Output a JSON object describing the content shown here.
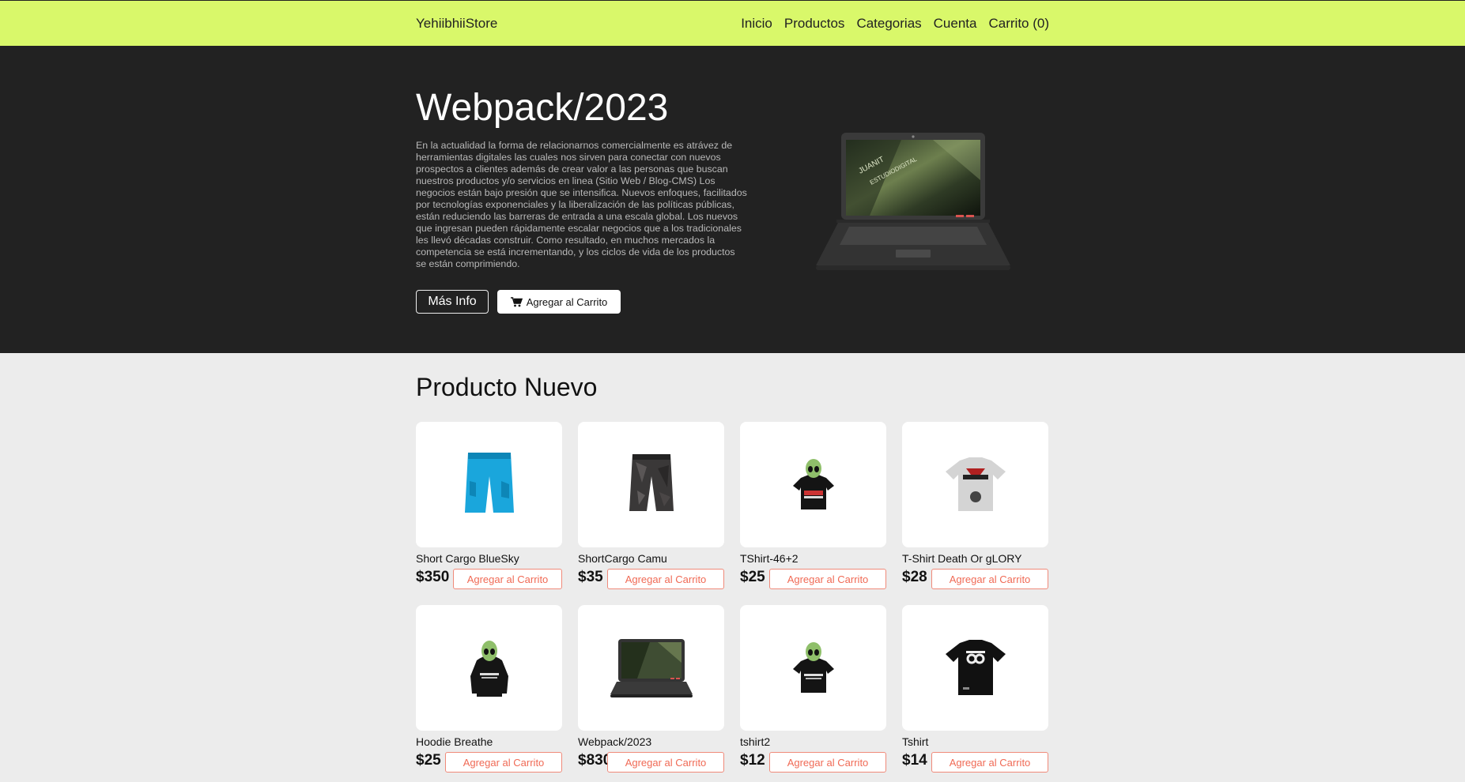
{
  "header": {
    "brand": "YehiibhiiStore",
    "nav": [
      "Inicio",
      "Productos",
      "Categorias",
      "Cuenta",
      "Carrito (0)"
    ]
  },
  "hero": {
    "title": "Webpack/2023",
    "description": "En la actualidad la forma de relacionarnos comercialmente es atrávez de herramientas digitales las cuales nos sirven para conectar con nuevos prospectos a clientes además de crear valor a las personas que buscan nuestros productos y/o servicios en linea (Sitio Web / Blog-CMS) Los negocios están bajo presión que se intensifica. Nuevos enfoques, facilitados por tecnologías exponenciales y la liberalización de las políticas públicas, están reduciendo las barreras de entrada a una escala global. Los nuevos que ingresan pueden rápidamente escalar negocios que a los tradicionales les llevó décadas construir. Como resultado, en muchos mercados la competencia se está incrementando, y los ciclos de vida de los productos se están comprimiendo.",
    "info_button": "Más Info",
    "cart_button": "Agregar al Carrito",
    "screen_text": [
      "JUANIT",
      "ESTUDIODIGITAL"
    ]
  },
  "section": {
    "title": "Producto Nuevo"
  },
  "products": [
    {
      "name": "Short Cargo BlueSky",
      "price": "$350",
      "button": "Agregar al Carrito",
      "image": "shorts-blue"
    },
    {
      "name": "ShortCargo Camu",
      "price": "$35",
      "button": "Agregar al Carrito",
      "image": "shorts-camo"
    },
    {
      "name": "TShirt-46+2",
      "price": "$25",
      "button": "Agregar al Carrito",
      "image": "alien-tshirt"
    },
    {
      "name": "T-Shirt Death Or gLORY",
      "price": "$28",
      "button": "Agregar al Carrito",
      "image": "grey-tshirt"
    },
    {
      "name": "Hoodie Breathe",
      "price": "$25",
      "button": "Agregar al Carrito",
      "image": "alien-hoodie"
    },
    {
      "name": "Webpack/2023",
      "price": "$830",
      "button": "Agregar al Carrito",
      "image": "laptop"
    },
    {
      "name": "tshirt2",
      "price": "$12",
      "button": "Agregar al Carrito",
      "image": "alien-tshirt-2"
    },
    {
      "name": "Tshirt",
      "price": "$14",
      "button": "Agregar al Carrito",
      "image": "black-tshirt"
    }
  ],
  "colors": {
    "topbar": "#d9f86a",
    "hero": "#222222",
    "page": "#ececec",
    "accent": "#f06a55"
  }
}
